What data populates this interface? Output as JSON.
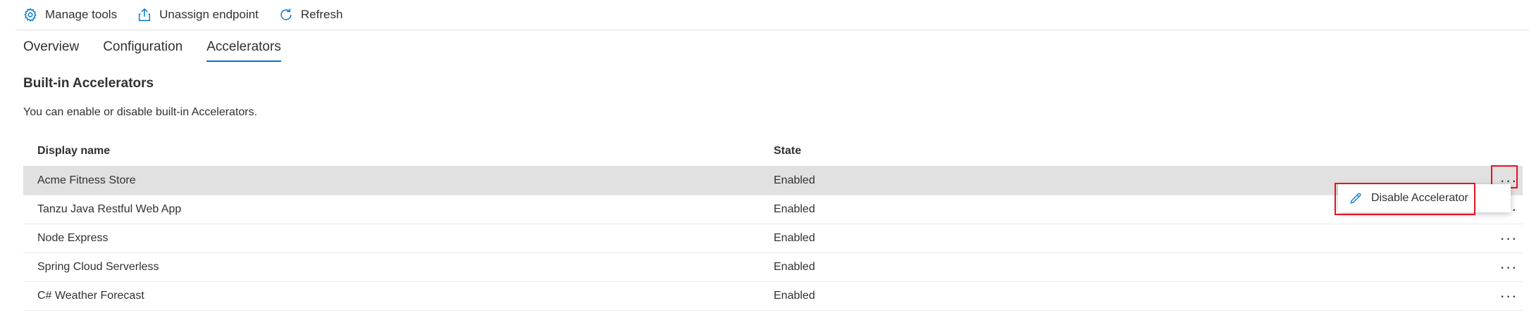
{
  "toolbar": {
    "manage_tools": "Manage tools",
    "unassign_endpoint": "Unassign endpoint",
    "refresh": "Refresh"
  },
  "tabs": [
    {
      "label": "Overview"
    },
    {
      "label": "Configuration"
    },
    {
      "label": "Accelerators"
    }
  ],
  "section": {
    "title": "Built-in Accelerators",
    "description": "You can enable or disable built-in Accelerators."
  },
  "table": {
    "headers": [
      "Display name",
      "State"
    ],
    "rows": [
      {
        "name": "Acme Fitness Store",
        "state": "Enabled"
      },
      {
        "name": "Tanzu Java Restful Web App",
        "state": "Enabled"
      },
      {
        "name": "Node Express",
        "state": "Enabled"
      },
      {
        "name": "Spring Cloud Serverless",
        "state": "Enabled"
      },
      {
        "name": "C# Weather Forecast",
        "state": "Enabled"
      }
    ]
  },
  "context_menu": {
    "disable_accelerator": "Disable Accelerator"
  },
  "colors": {
    "accent": "#0078d4",
    "highlight_box": "#e81123",
    "selected_row": "#e1e1e1"
  }
}
